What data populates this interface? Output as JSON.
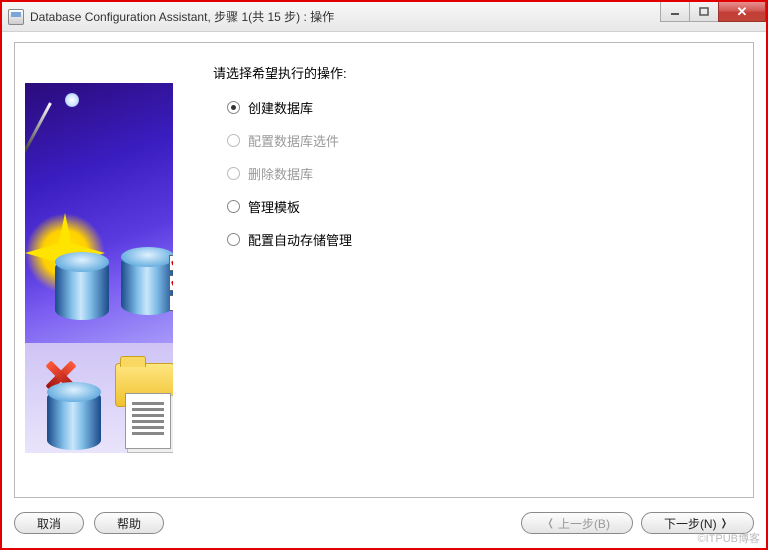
{
  "window": {
    "title": "Database Configuration Assistant, 步骤 1(共 15 步) : 操作"
  },
  "prompt": "请选择希望执行的操作:",
  "options": [
    {
      "label": "创建数据库",
      "selected": true,
      "enabled": true
    },
    {
      "label": "配置数据库选件",
      "selected": false,
      "enabled": false
    },
    {
      "label": "删除数据库",
      "selected": false,
      "enabled": false
    },
    {
      "label": "管理模板",
      "selected": false,
      "enabled": true
    },
    {
      "label": "配置自动存储管理",
      "selected": false,
      "enabled": true
    }
  ],
  "buttons": {
    "cancel": "取消",
    "help": "帮助",
    "back": "上一步(B)",
    "next": "下一步(N)"
  },
  "watermark": "©ITPUB博客"
}
